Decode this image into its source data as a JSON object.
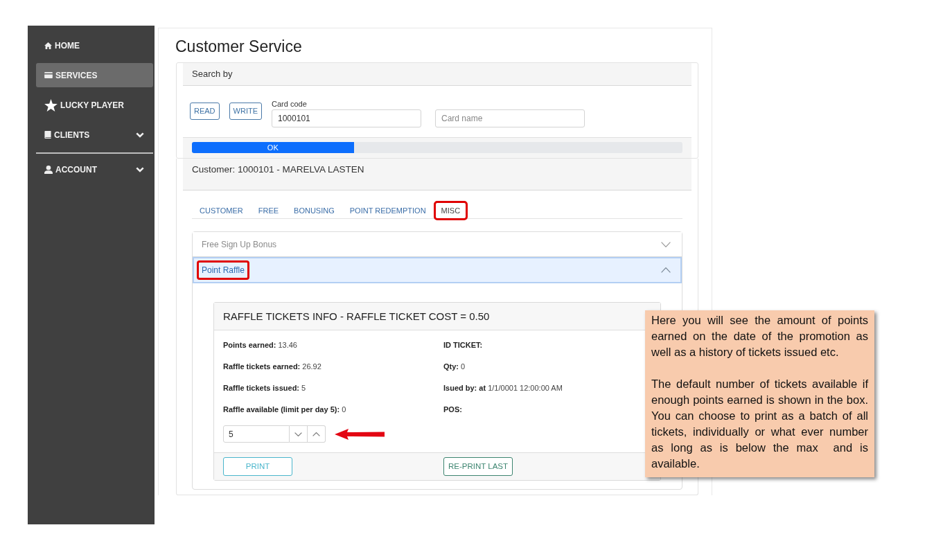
{
  "sidebar": {
    "sections": [
      {
        "items": [
          {
            "label": "HOME",
            "selected": false,
            "submenu": false
          },
          {
            "label": "SERVICES",
            "selected": true,
            "submenu": false
          },
          {
            "label": "LUCKY PLAYER",
            "selected": false,
            "submenu": false
          },
          {
            "label": "CLIENTS",
            "selected": false,
            "submenu": true
          }
        ]
      },
      {
        "items": [
          {
            "label": "ACCOUNT",
            "selected": false,
            "submenu": true
          }
        ]
      }
    ]
  },
  "page_title": "Customer Service",
  "search_panel": {
    "title": "Search by",
    "buttons": [
      "READ",
      "WRITE"
    ],
    "fields": [
      {
        "label": "Card code",
        "value": "1000101"
      },
      {
        "placeholder": "Card name"
      }
    ],
    "progress": {
      "level": 0.33,
      "text": "OK"
    }
  },
  "customer_header": "Customer: 1000101 - MARELVA LASTEN",
  "tabs": [
    {
      "label": "CUSTOMER",
      "selected": false,
      "highlighted": false
    },
    {
      "label": "FREE",
      "selected": false,
      "highlighted": false
    },
    {
      "label": "BONUSING",
      "selected": false,
      "highlighted": false
    },
    {
      "label": "POINT REDEMPTION",
      "selected": false,
      "highlighted": false
    },
    {
      "label": "MISC",
      "selected": true,
      "highlighted": true
    }
  ],
  "accordion": [
    {
      "title": "Free Sign Up Bonus",
      "expanded": false,
      "highlighted": false
    },
    {
      "title": "Point Raffle",
      "expanded": true,
      "highlighted": true,
      "panel": {
        "title": "RAFFLE TICKETS INFO - RAFFLE TICKET COST = 0.50",
        "left": [
          {
            "label": "Points earned:",
            "value": "13.46"
          },
          {
            "label": "Raffle tickets earned:",
            "value": "26.92"
          },
          {
            "label": "Raffle tickets issued:",
            "value": "5"
          },
          {
            "label": "Raffle available (limit per day 5):",
            "value": "0"
          }
        ],
        "right": [
          {
            "label": "ID TICKET:"
          },
          {
            "label": "Qty:",
            "value": "0"
          },
          {
            "label": "Isued by: at",
            "value": "1/1/0001 12:00:00 AM"
          },
          {
            "label": "POS:"
          }
        ],
        "quantity": "5",
        "buttons": [
          {
            "label": "PRINT",
            "kind": "info"
          },
          {
            "label": "RE-PRINT LAST",
            "kind": "success"
          }
        ]
      }
    }
  ],
  "callout": {
    "paragraphs": [
      "Here you will see the amount of points earned on the date of the promotion as well as a history of tickets issued etc.",
      "The default number of tickets available if enough points earned is shown in the box. You can choose to print as a batch of all tickets, individually or what ever number as long as is below the max  and is available."
    ]
  }
}
